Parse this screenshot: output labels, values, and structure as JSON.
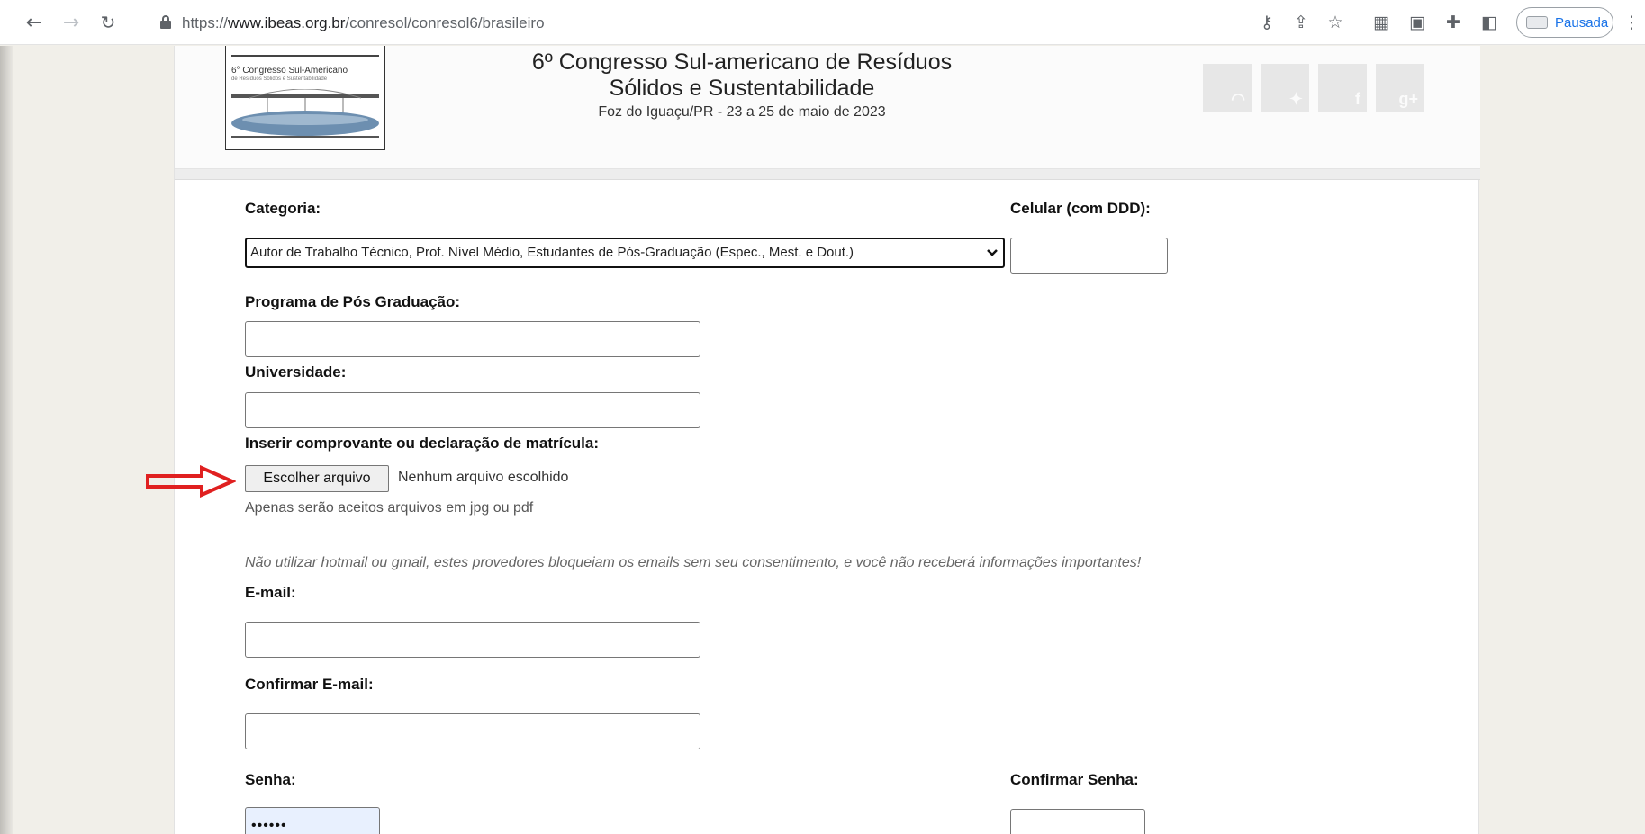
{
  "browser": {
    "url_prefix": "https://",
    "url_host": "www.ibeas.org.br",
    "url_path": "/conresol/conresol6/brasileiro",
    "profile_status": "Pausada"
  },
  "header": {
    "logo_line1": "6° Congresso Sul-Americano",
    "logo_line2": "de Resíduos Sólidos e Sustentabilidade",
    "title": "6º Congresso Sul-americano de Resíduos Sólidos e Sustentabilidade",
    "subtitle": "Foz do Iguaçu/PR - 23 a 25 de maio de 2023",
    "social_icons": [
      "rss-icon",
      "twitter-icon",
      "facebook-icon",
      "google-plus-icon"
    ]
  },
  "form": {
    "categoria_label": "Categoria:",
    "categoria_value": "Autor de Trabalho Técnico, Prof. Nível Médio, Estudantes de Pós-Graduação (Espec., Mest. e Dout.)",
    "celular_label": "Celular (com DDD):",
    "programa_label": "Programa de Pós Graduação:",
    "universidade_label": "Universidade:",
    "comprovante_label": "Inserir comprovante ou declaração de matrícula:",
    "file_button": "Escolher arquivo",
    "file_status": "Nenhum arquivo escolhido",
    "file_hint": "Apenas serão aceitos arquivos em jpg ou pdf",
    "email_warning": "Não utilizar hotmail ou gmail, estes provedores bloqueiam os emails sem seu consentimento, e você não receberá informações importantes!",
    "email_label": "E-mail:",
    "confirm_email_label": "Confirmar E-mail:",
    "senha_label": "Senha:",
    "confirm_senha_label": "Confirmar Senha:",
    "senha_value": "••••••"
  },
  "colors": {
    "annotation_arrow": "#e02020",
    "link_blue": "#1a73e8"
  }
}
